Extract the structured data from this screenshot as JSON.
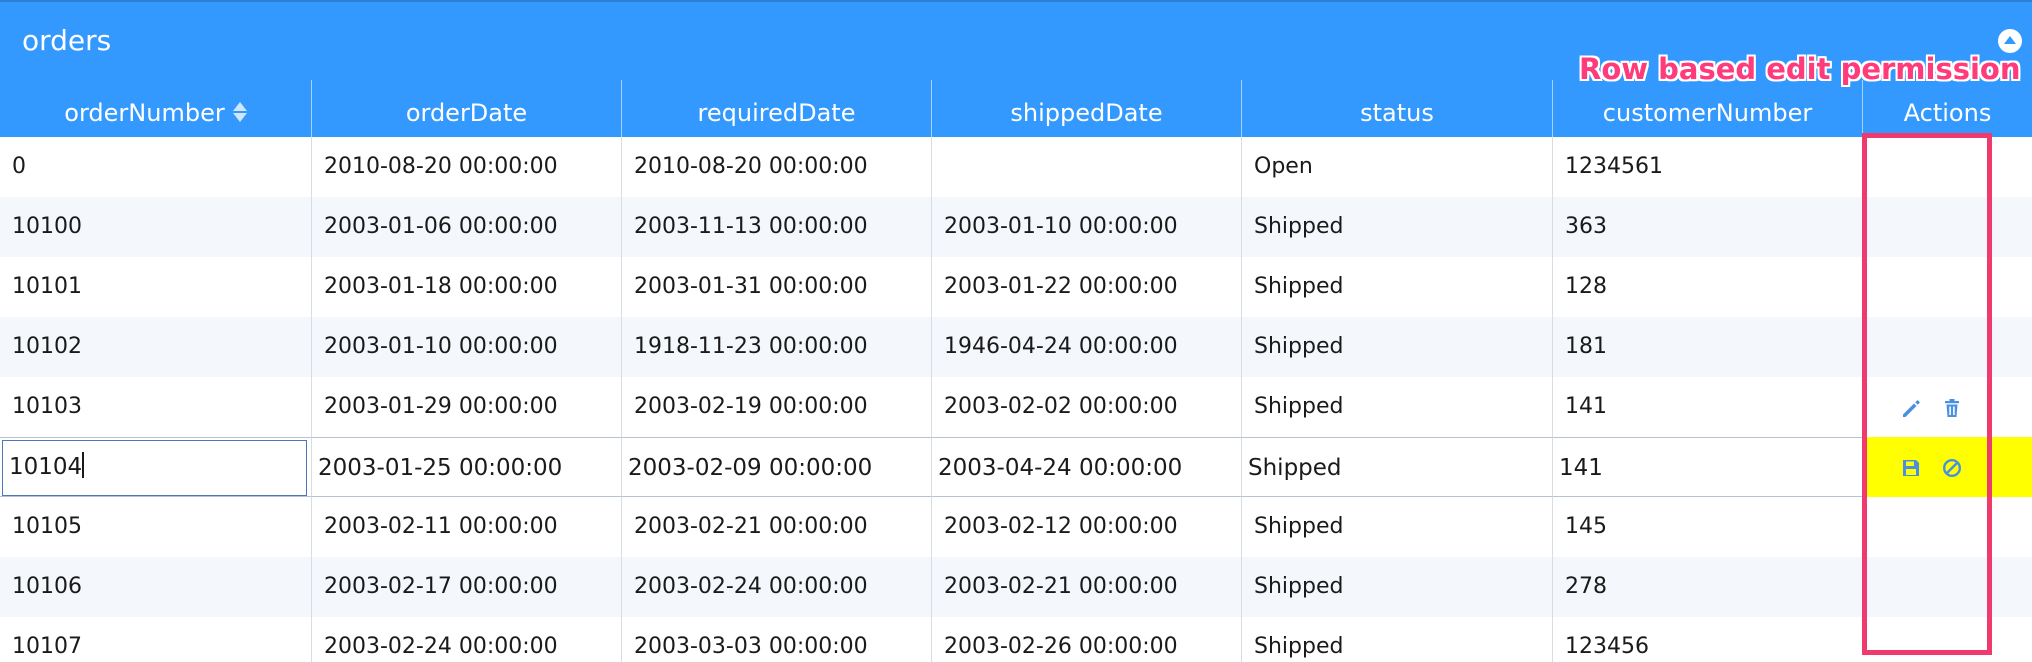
{
  "panel": {
    "title": "orders"
  },
  "columns": [
    "orderNumber",
    "orderDate",
    "requiredDate",
    "shippedDate",
    "status",
    "customerNumber",
    "Actions"
  ],
  "rows": [
    [
      "0",
      "2010-08-20 00:00:00",
      "2010-08-20 00:00:00",
      "",
      "Open",
      "1234561"
    ],
    [
      "10100",
      "2003-01-06 00:00:00",
      "2003-11-13 00:00:00",
      "2003-01-10 00:00:00",
      "Shipped",
      "363"
    ],
    [
      "10101",
      "2003-01-18 00:00:00",
      "2003-01-31 00:00:00",
      "2003-01-22 00:00:00",
      "Shipped",
      "128"
    ],
    [
      "10102",
      "2003-01-10 00:00:00",
      "1918-11-23 00:00:00",
      "1946-04-24 00:00:00",
      "Shipped",
      "181"
    ],
    [
      "10103",
      "2003-01-29 00:00:00",
      "2003-02-19 00:00:00",
      "2003-02-02 00:00:00",
      "Shipped",
      "141"
    ],
    [
      "10104",
      "2003-01-25 00:00:00",
      "2003-02-09 00:00:00",
      "2003-04-24 00:00:00",
      "Shipped",
      "141"
    ],
    [
      "10105",
      "2003-02-11 00:00:00",
      "2003-02-21 00:00:00",
      "2003-02-12 00:00:00",
      "Shipped",
      "145"
    ],
    [
      "10106",
      "2003-02-17 00:00:00",
      "2003-02-24 00:00:00",
      "2003-02-21 00:00:00",
      "Shipped",
      "278"
    ],
    [
      "10107",
      "2003-02-24 00:00:00",
      "2003-03-03 00:00:00",
      "2003-02-26 00:00:00",
      "Shipped",
      "123456"
    ]
  ],
  "row_actions": [
    [],
    [],
    [],
    [],
    [
      "pencil-edit-icon",
      "trash-delete-icon"
    ],
    [
      "save-floppy-icon",
      "cancel-circle-icon"
    ],
    [],
    [],
    []
  ],
  "editing_row_index": 5,
  "sorted_column": "orderNumber",
  "annotation": {
    "text": "Row based edit permission"
  },
  "colors": {
    "header_blue": "#3399ff",
    "editing_actions_highlight": "#ffff00",
    "annotation_pink": "#ee3a6c",
    "action_icon_blue": "#4a90e2"
  }
}
